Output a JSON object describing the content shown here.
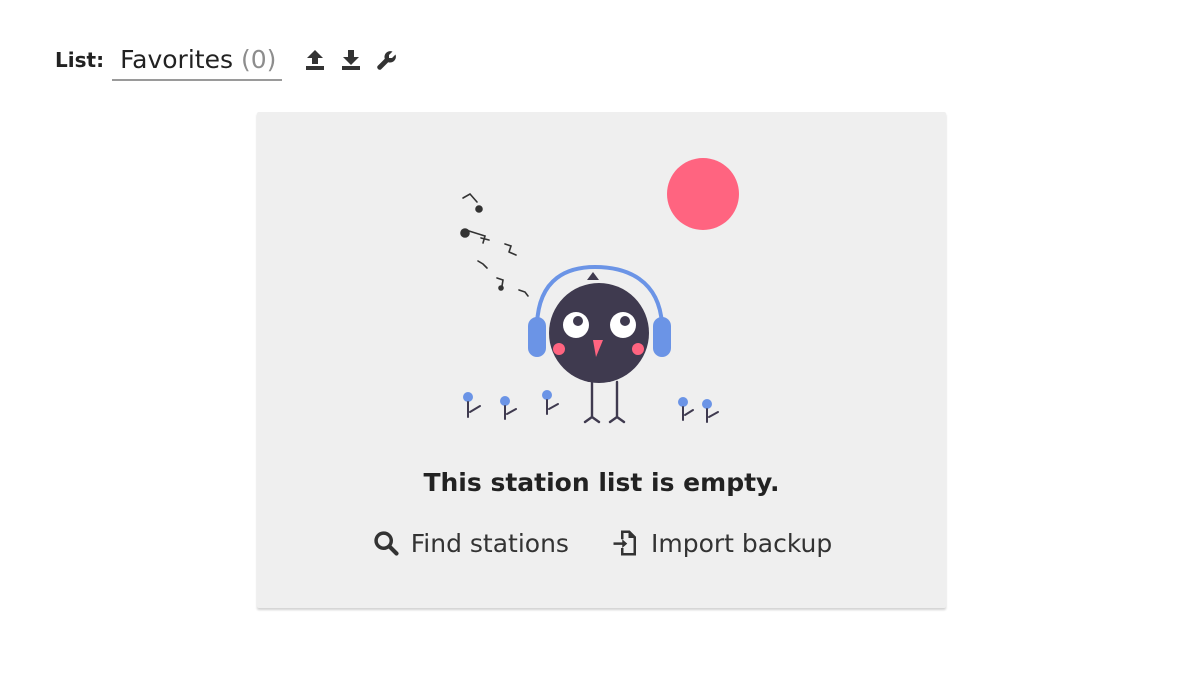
{
  "header": {
    "list_label": "List:",
    "selected_list": "Favorites",
    "count": "(0)",
    "icons": [
      "upload-icon",
      "download-icon",
      "wrench-icon"
    ]
  },
  "empty_state": {
    "title": "This station list is empty.",
    "actions": [
      {
        "label": "Find stations",
        "icon": "search-icon"
      },
      {
        "label": "Import backup",
        "icon": "import-file-icon"
      }
    ],
    "illustration": {
      "subject": "bird-with-headphones",
      "colors": {
        "bird": "#3f3a4f",
        "headphones": "#6b94e6",
        "sun": "#ff6480",
        "cheeks": "#ff6480",
        "flowers": "#6b94e6",
        "notes": "#333333"
      }
    }
  },
  "colors": {
    "card_background": "#efefef",
    "underline": "#9a9a9a",
    "count_text": "#8d8d8d"
  }
}
